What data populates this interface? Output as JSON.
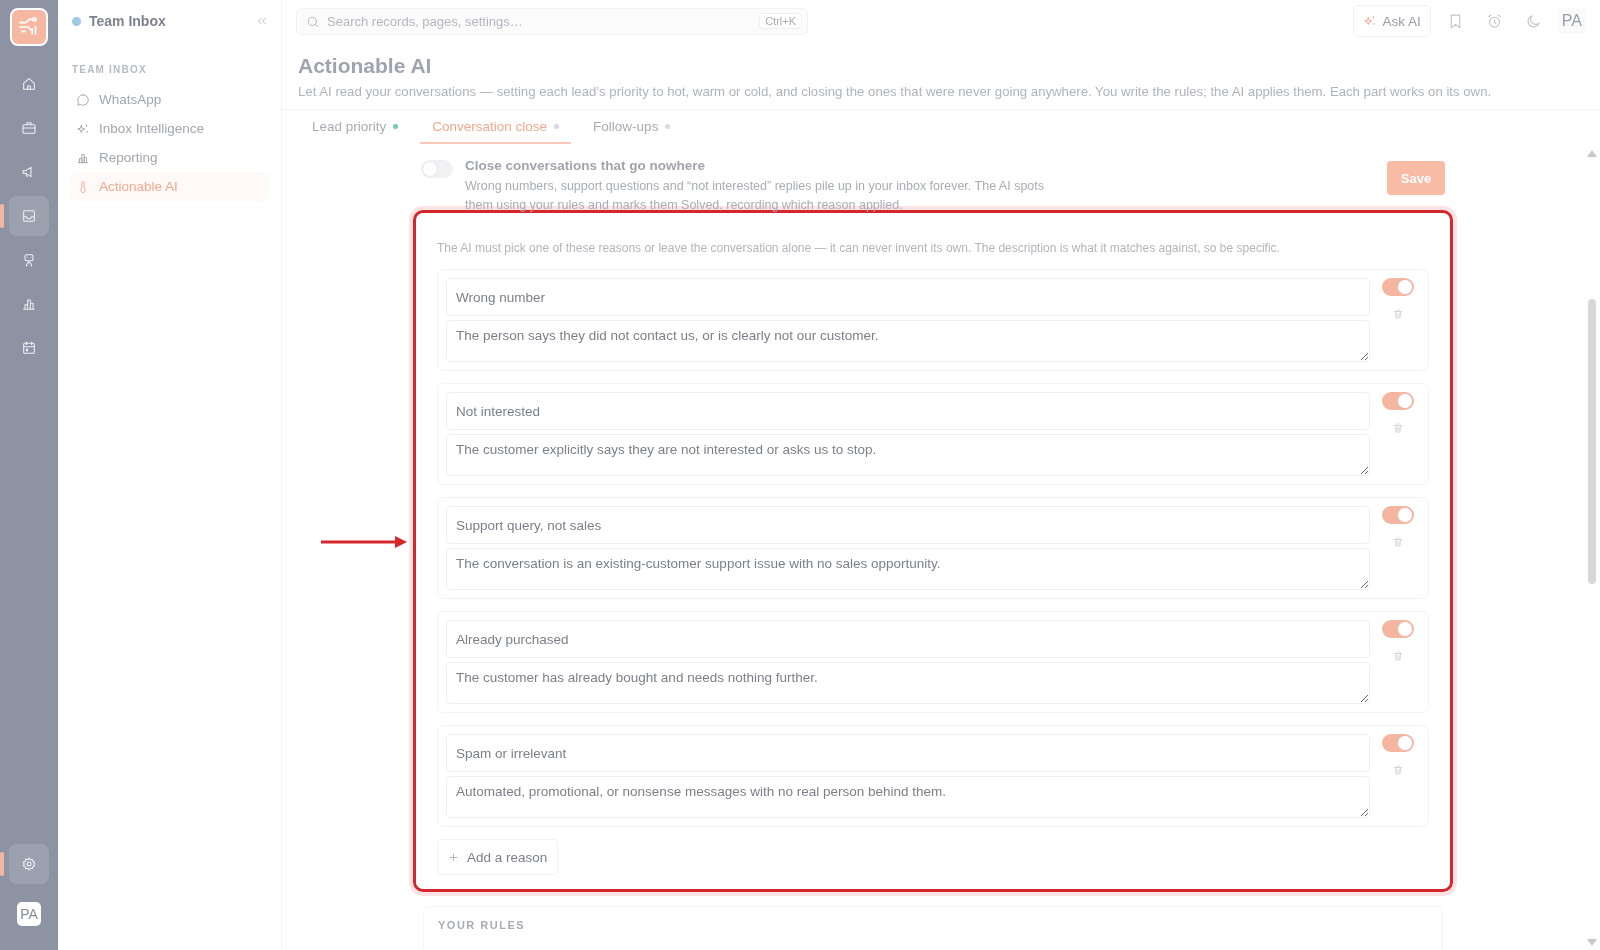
{
  "rail": {
    "items": [
      {
        "kind": "home",
        "selected": false
      },
      {
        "kind": "briefcase",
        "selected": false
      },
      {
        "kind": "megaphone",
        "selected": false
      },
      {
        "kind": "inbox",
        "selected": true
      },
      {
        "kind": "robot",
        "selected": false
      },
      {
        "kind": "chart",
        "selected": false
      },
      {
        "kind": "calendar",
        "selected": false
      }
    ],
    "settings": {
      "selected": true
    },
    "avatar": "PA"
  },
  "sidebar": {
    "title": "Team Inbox",
    "section": "TEAM INBOX",
    "items": [
      {
        "label": "WhatsApp",
        "kind": "chat",
        "selected": false
      },
      {
        "label": "Inbox Intelligence",
        "kind": "sparkle",
        "selected": false
      },
      {
        "label": "Reporting",
        "kind": "chart",
        "selected": false
      },
      {
        "label": "Actionable AI",
        "kind": "thermometer",
        "selected": true
      }
    ]
  },
  "topbar": {
    "search": {
      "placeholder": "Search records, pages, settings…",
      "shortcut": "Ctrl+K"
    },
    "ask_ai": "Ask AI",
    "avatar": "PA"
  },
  "page": {
    "title": "Actionable AI",
    "description": "Let AI read your conversations — setting each lead’s priority to hot, warm or cold, and closing the ones that were never going anywhere. You write the rules; the AI applies them. Each part works on its own."
  },
  "tabs": [
    {
      "label": "Lead priority",
      "selected": false,
      "color": "#6fcf9f"
    },
    {
      "label": "Conversation close",
      "selected": true,
      "color": "#d9d9de"
    },
    {
      "label": "Follow-ups",
      "selected": false,
      "color": "#d9d9de"
    }
  ],
  "feature": {
    "title": "Close conversations that go nowhere",
    "description": "Wrong numbers, support questions and “not interested” replies pile up in your inbox forever. The AI spots them using your rules and marks them Solved, recording which reason applied.",
    "on": false,
    "save": "Save",
    "save_disabled": true
  },
  "reasons": {
    "hint": "The AI must pick one of these reasons or leave the conversation alone — it can never invent its own. The description is what it matches against, so be specific.",
    "items": [
      {
        "name": "Wrong number",
        "description": "The person says they did not contact us, or is clearly not our customer.",
        "enabled": true
      },
      {
        "name": "Not interested",
        "description": "The customer explicitly says they are not interested or asks us to stop.",
        "enabled": true
      },
      {
        "name": "Support query, not sales",
        "description": "The conversation is an existing-customer support issue with no sales opportunity.",
        "enabled": true
      },
      {
        "name": "Already purchased",
        "description": "The customer has already bought and needs nothing further.",
        "enabled": true
      },
      {
        "name": "Spam or irrelevant",
        "description": "Automated, promotional, or nonsense messages with no real person behind them.",
        "enabled": true
      }
    ],
    "add": "Add a reason"
  },
  "rules": {
    "heading": "YOUR RULES"
  }
}
